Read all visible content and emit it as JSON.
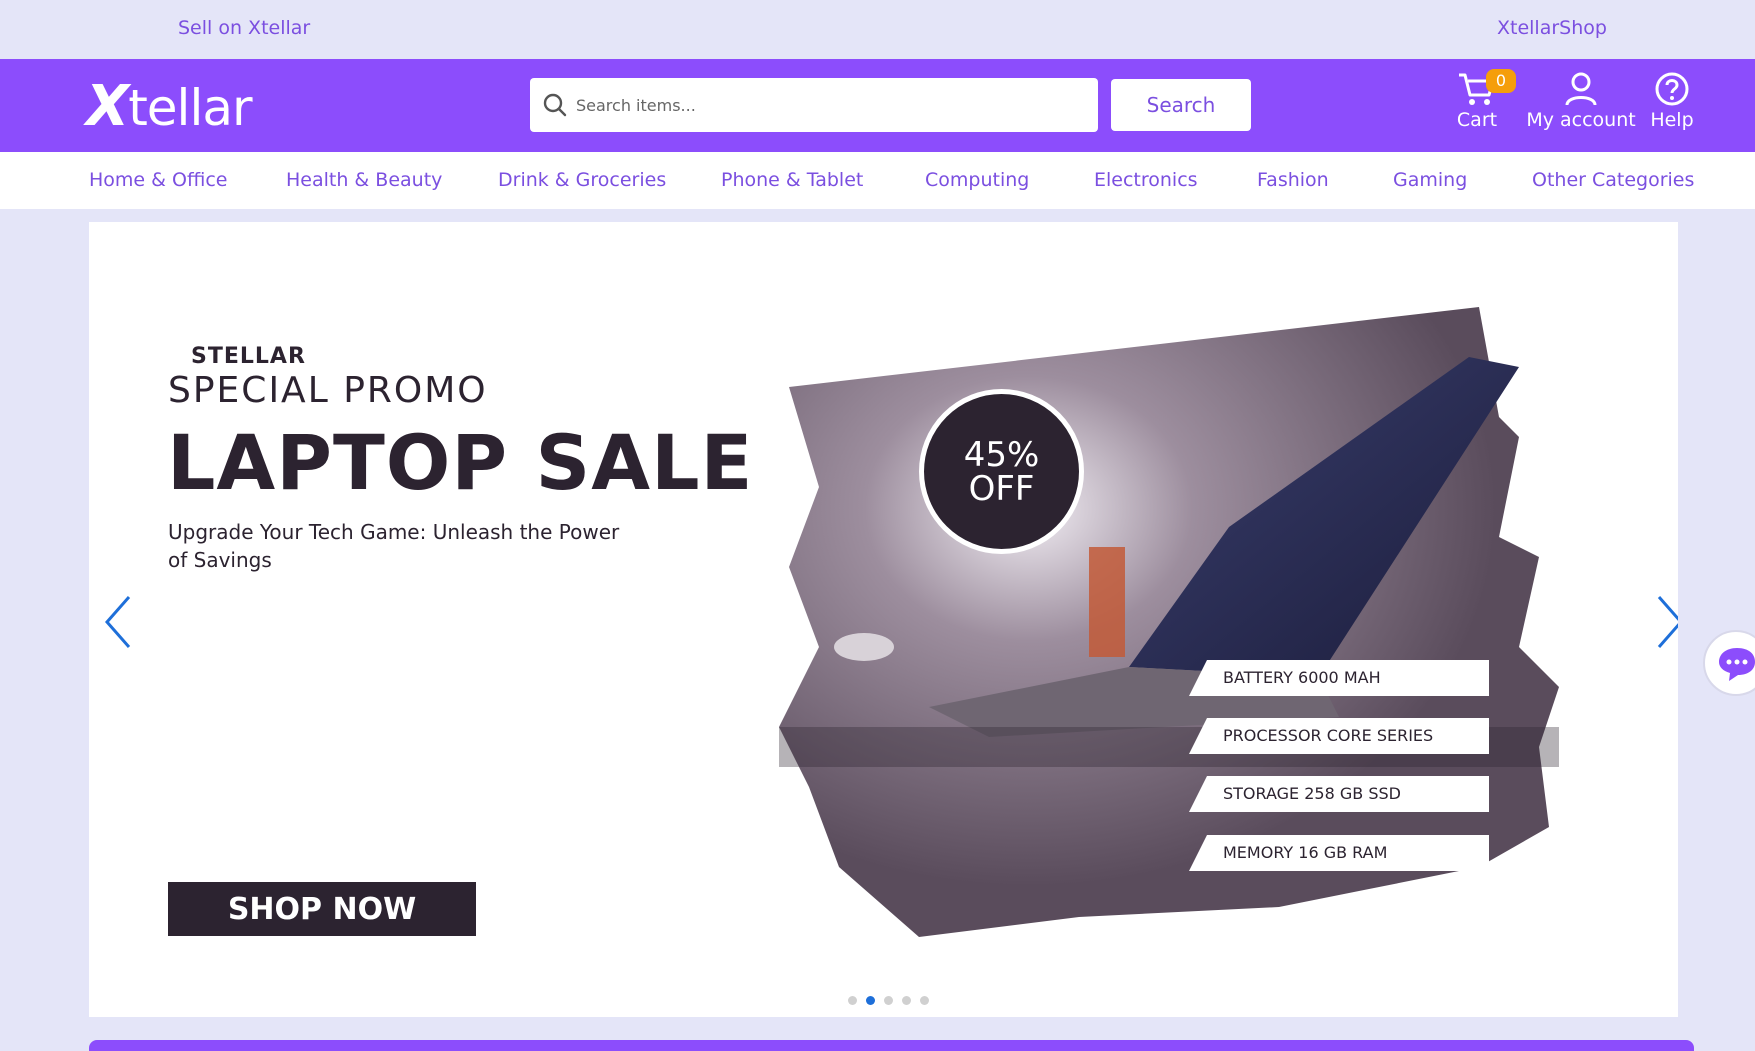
{
  "topbar": {
    "sell": "Sell on Xtellar",
    "shop": "XtellarShop"
  },
  "header": {
    "logo": "Xtellar",
    "search_placeholder": "Search items...",
    "search_button": "Search",
    "cart_label": "Cart",
    "cart_count": "0",
    "account_label": "My account",
    "help_label": "Help"
  },
  "categories": [
    "Home & Office",
    "Health & Beauty",
    "Drink & Groceries",
    "Phone & Tablet",
    "Computing",
    "Electronics",
    "Fashion",
    "Gaming",
    "Other Categories"
  ],
  "banner": {
    "brand": "STELLAR",
    "special": "SPECIAL PROMO",
    "title": "LAPTOP SALE",
    "subtitle": "Upgrade Your Tech Game: Unleash the Power of Savings",
    "cta": "SHOP NOW",
    "discount_1": "45%",
    "discount_2": "OFF",
    "specs": [
      "BATTERY 6000 MAH",
      "PROCESSOR CORE SERIES",
      "STORAGE 258 GB SSD",
      "MEMORY 16 GB RAM"
    ],
    "slide_count": 5,
    "active_slide": 2
  },
  "colors": {
    "brand": "#8c4dfc",
    "accent_text": "#7b4fe0",
    "dark": "#2c2330",
    "dot_active": "#1e6fd9",
    "badge": "#f59e0b"
  }
}
